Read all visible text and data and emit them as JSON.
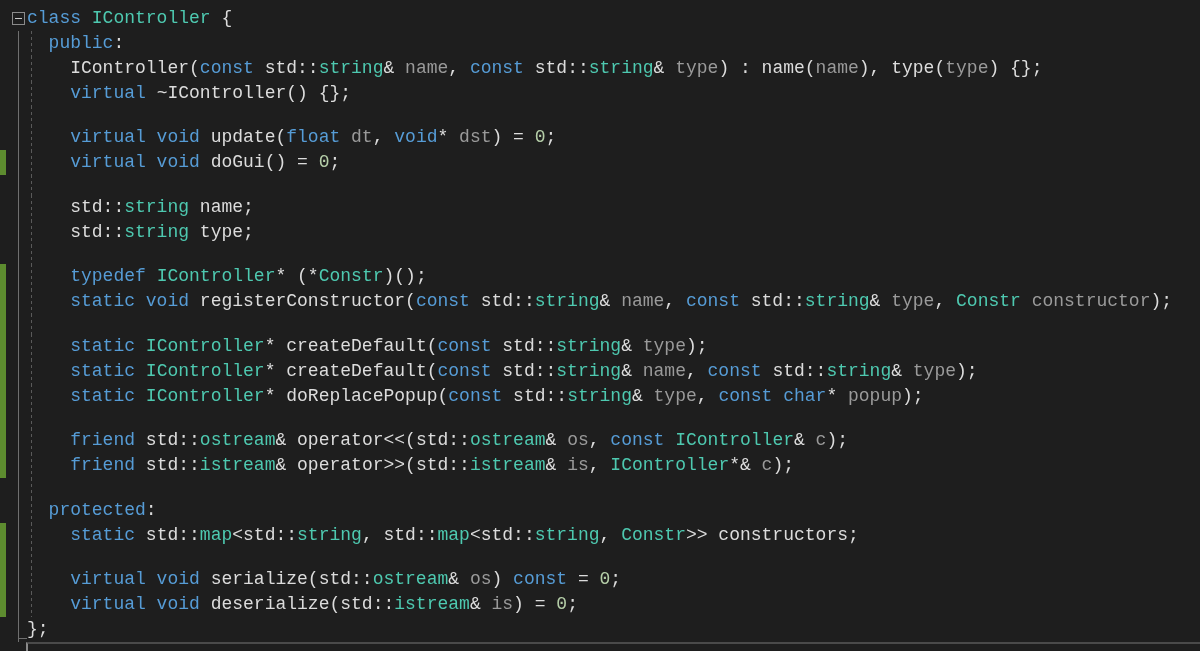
{
  "editor": {
    "lines": [
      {
        "kind": "fold-start",
        "changed": false,
        "tokens": [
          {
            "kind": "keyword",
            "text": "class "
          },
          {
            "kind": "type",
            "text": "IController"
          },
          {
            "kind": "plain",
            "text": " {"
          }
        ]
      },
      {
        "kind": "code",
        "changed": false,
        "tokens": [
          {
            "kind": "keyword",
            "text": "  public"
          },
          {
            "kind": "plain",
            "text": ":"
          }
        ]
      },
      {
        "kind": "code",
        "changed": false,
        "tokens": [
          {
            "kind": "plain",
            "text": "    IController("
          },
          {
            "kind": "keyword",
            "text": "const"
          },
          {
            "kind": "plain",
            "text": " std::"
          },
          {
            "kind": "type",
            "text": "string"
          },
          {
            "kind": "plain",
            "text": "& "
          },
          {
            "kind": "param",
            "text": "name"
          },
          {
            "kind": "plain",
            "text": ", "
          },
          {
            "kind": "keyword",
            "text": "const"
          },
          {
            "kind": "plain",
            "text": " std::"
          },
          {
            "kind": "type",
            "text": "string"
          },
          {
            "kind": "plain",
            "text": "& "
          },
          {
            "kind": "param",
            "text": "type"
          },
          {
            "kind": "plain",
            "text": ") : name("
          },
          {
            "kind": "param",
            "text": "name"
          },
          {
            "kind": "plain",
            "text": "), type("
          },
          {
            "kind": "param",
            "text": "type"
          },
          {
            "kind": "plain",
            "text": ") {};"
          }
        ]
      },
      {
        "kind": "code",
        "changed": false,
        "tokens": [
          {
            "kind": "keyword",
            "text": "    virtual"
          },
          {
            "kind": "plain",
            "text": " ~IController() {};"
          }
        ]
      },
      {
        "kind": "blank",
        "changed": false
      },
      {
        "kind": "code",
        "changed": false,
        "tokens": [
          {
            "kind": "keyword",
            "text": "    virtual void"
          },
          {
            "kind": "plain",
            "text": " update("
          },
          {
            "kind": "keyword",
            "text": "float"
          },
          {
            "kind": "param",
            "text": " dt"
          },
          {
            "kind": "plain",
            "text": ", "
          },
          {
            "kind": "keyword",
            "text": "void"
          },
          {
            "kind": "plain",
            "text": "* "
          },
          {
            "kind": "param",
            "text": "dst"
          },
          {
            "kind": "plain",
            "text": ") = "
          },
          {
            "kind": "number",
            "text": "0"
          },
          {
            "kind": "plain",
            "text": ";"
          }
        ]
      },
      {
        "kind": "code",
        "changed": true,
        "tokens": [
          {
            "kind": "keyword",
            "text": "    virtual void"
          },
          {
            "kind": "plain",
            "text": " doGui() = "
          },
          {
            "kind": "number",
            "text": "0"
          },
          {
            "kind": "plain",
            "text": ";"
          }
        ]
      },
      {
        "kind": "blank",
        "changed": false
      },
      {
        "kind": "code",
        "changed": false,
        "tokens": [
          {
            "kind": "plain",
            "text": "    std::"
          },
          {
            "kind": "type",
            "text": "string"
          },
          {
            "kind": "plain",
            "text": " name;"
          }
        ]
      },
      {
        "kind": "code",
        "changed": false,
        "tokens": [
          {
            "kind": "plain",
            "text": "    std::"
          },
          {
            "kind": "type",
            "text": "string"
          },
          {
            "kind": "plain",
            "text": " type;"
          }
        ]
      },
      {
        "kind": "blank",
        "changed": false
      },
      {
        "kind": "code",
        "changed": true,
        "tokens": [
          {
            "kind": "keyword",
            "text": "    typedef "
          },
          {
            "kind": "type",
            "text": "IController"
          },
          {
            "kind": "plain",
            "text": "* (*"
          },
          {
            "kind": "type",
            "text": "Constr"
          },
          {
            "kind": "plain",
            "text": ")();"
          }
        ]
      },
      {
        "kind": "code",
        "changed": true,
        "tokens": [
          {
            "kind": "keyword",
            "text": "    static void"
          },
          {
            "kind": "plain",
            "text": " registerConstructor("
          },
          {
            "kind": "keyword",
            "text": "const"
          },
          {
            "kind": "plain",
            "text": " std::"
          },
          {
            "kind": "type",
            "text": "string"
          },
          {
            "kind": "plain",
            "text": "& "
          },
          {
            "kind": "param",
            "text": "name"
          },
          {
            "kind": "plain",
            "text": ", "
          },
          {
            "kind": "keyword",
            "text": "const"
          },
          {
            "kind": "plain",
            "text": " std::"
          },
          {
            "kind": "type",
            "text": "string"
          },
          {
            "kind": "plain",
            "text": "& "
          },
          {
            "kind": "param",
            "text": "type"
          },
          {
            "kind": "plain",
            "text": ", "
          },
          {
            "kind": "type",
            "text": "Constr"
          },
          {
            "kind": "param",
            "text": " constructor"
          },
          {
            "kind": "plain",
            "text": ");"
          }
        ]
      },
      {
        "kind": "blank",
        "changed": true
      },
      {
        "kind": "code",
        "changed": true,
        "tokens": [
          {
            "kind": "keyword",
            "text": "    static "
          },
          {
            "kind": "type",
            "text": "IController"
          },
          {
            "kind": "plain",
            "text": "* createDefault("
          },
          {
            "kind": "keyword",
            "text": "const"
          },
          {
            "kind": "plain",
            "text": " std::"
          },
          {
            "kind": "type",
            "text": "string"
          },
          {
            "kind": "plain",
            "text": "& "
          },
          {
            "kind": "param",
            "text": "type"
          },
          {
            "kind": "plain",
            "text": ");"
          }
        ]
      },
      {
        "kind": "code",
        "changed": true,
        "tokens": [
          {
            "kind": "keyword",
            "text": "    static "
          },
          {
            "kind": "type",
            "text": "IController"
          },
          {
            "kind": "plain",
            "text": "* createDefault("
          },
          {
            "kind": "keyword",
            "text": "const"
          },
          {
            "kind": "plain",
            "text": " std::"
          },
          {
            "kind": "type",
            "text": "string"
          },
          {
            "kind": "plain",
            "text": "& "
          },
          {
            "kind": "param",
            "text": "name"
          },
          {
            "kind": "plain",
            "text": ", "
          },
          {
            "kind": "keyword",
            "text": "const"
          },
          {
            "kind": "plain",
            "text": " std::"
          },
          {
            "kind": "type",
            "text": "string"
          },
          {
            "kind": "plain",
            "text": "& "
          },
          {
            "kind": "param",
            "text": "type"
          },
          {
            "kind": "plain",
            "text": ");"
          }
        ]
      },
      {
        "kind": "code",
        "changed": true,
        "tokens": [
          {
            "kind": "keyword",
            "text": "    static "
          },
          {
            "kind": "type",
            "text": "IController"
          },
          {
            "kind": "plain",
            "text": "* doReplacePopup("
          },
          {
            "kind": "keyword",
            "text": "const"
          },
          {
            "kind": "plain",
            "text": " std::"
          },
          {
            "kind": "type",
            "text": "string"
          },
          {
            "kind": "plain",
            "text": "& "
          },
          {
            "kind": "param",
            "text": "type"
          },
          {
            "kind": "plain",
            "text": ", "
          },
          {
            "kind": "keyword",
            "text": "const char"
          },
          {
            "kind": "plain",
            "text": "* "
          },
          {
            "kind": "param",
            "text": "popup"
          },
          {
            "kind": "plain",
            "text": ");"
          }
        ]
      },
      {
        "kind": "blank",
        "changed": true
      },
      {
        "kind": "code",
        "changed": true,
        "tokens": [
          {
            "kind": "keyword",
            "text": "    friend"
          },
          {
            "kind": "plain",
            "text": " std::"
          },
          {
            "kind": "type",
            "text": "ostream"
          },
          {
            "kind": "plain",
            "text": "& operator<<(std::"
          },
          {
            "kind": "type",
            "text": "ostream"
          },
          {
            "kind": "plain",
            "text": "& "
          },
          {
            "kind": "param",
            "text": "os"
          },
          {
            "kind": "plain",
            "text": ", "
          },
          {
            "kind": "keyword",
            "text": "const "
          },
          {
            "kind": "type",
            "text": "IController"
          },
          {
            "kind": "plain",
            "text": "& "
          },
          {
            "kind": "param",
            "text": "c"
          },
          {
            "kind": "plain",
            "text": ");"
          }
        ]
      },
      {
        "kind": "code",
        "changed": true,
        "tokens": [
          {
            "kind": "keyword",
            "text": "    friend"
          },
          {
            "kind": "plain",
            "text": " std::"
          },
          {
            "kind": "type",
            "text": "istream"
          },
          {
            "kind": "plain",
            "text": "& operator>>(std::"
          },
          {
            "kind": "type",
            "text": "istream"
          },
          {
            "kind": "plain",
            "text": "& "
          },
          {
            "kind": "param",
            "text": "is"
          },
          {
            "kind": "plain",
            "text": ", "
          },
          {
            "kind": "type",
            "text": "IController"
          },
          {
            "kind": "plain",
            "text": "*& "
          },
          {
            "kind": "param",
            "text": "c"
          },
          {
            "kind": "plain",
            "text": ");"
          }
        ]
      },
      {
        "kind": "blank",
        "changed": false
      },
      {
        "kind": "code",
        "changed": false,
        "tokens": [
          {
            "kind": "keyword",
            "text": "  protected"
          },
          {
            "kind": "plain",
            "text": ":"
          }
        ]
      },
      {
        "kind": "code",
        "changed": true,
        "tokens": [
          {
            "kind": "keyword",
            "text": "    static"
          },
          {
            "kind": "plain",
            "text": " std::"
          },
          {
            "kind": "type",
            "text": "map"
          },
          {
            "kind": "plain",
            "text": "<std::"
          },
          {
            "kind": "type",
            "text": "string"
          },
          {
            "kind": "plain",
            "text": ", std::"
          },
          {
            "kind": "type",
            "text": "map"
          },
          {
            "kind": "plain",
            "text": "<std::"
          },
          {
            "kind": "type",
            "text": "string"
          },
          {
            "kind": "plain",
            "text": ", "
          },
          {
            "kind": "type",
            "text": "Constr"
          },
          {
            "kind": "plain",
            "text": ">> constructors;"
          }
        ]
      },
      {
        "kind": "blank",
        "changed": true
      },
      {
        "kind": "code",
        "changed": true,
        "tokens": [
          {
            "kind": "keyword",
            "text": "    virtual void"
          },
          {
            "kind": "plain",
            "text": " serialize(std::"
          },
          {
            "kind": "type",
            "text": "ostream"
          },
          {
            "kind": "plain",
            "text": "& "
          },
          {
            "kind": "param",
            "text": "os"
          },
          {
            "kind": "plain",
            "text": ") "
          },
          {
            "kind": "keyword",
            "text": "const"
          },
          {
            "kind": "plain",
            "text": " = "
          },
          {
            "kind": "number",
            "text": "0"
          },
          {
            "kind": "plain",
            "text": ";"
          }
        ]
      },
      {
        "kind": "code",
        "changed": true,
        "tokens": [
          {
            "kind": "keyword",
            "text": "    virtual void"
          },
          {
            "kind": "plain",
            "text": " deserialize(std::"
          },
          {
            "kind": "type",
            "text": "istream"
          },
          {
            "kind": "plain",
            "text": "& "
          },
          {
            "kind": "param",
            "text": "is"
          },
          {
            "kind": "plain",
            "text": ") = "
          },
          {
            "kind": "number",
            "text": "0"
          },
          {
            "kind": "plain",
            "text": ";"
          }
        ]
      },
      {
        "kind": "fold-end",
        "changed": false,
        "tokens": [
          {
            "kind": "plain",
            "text": "};"
          }
        ]
      }
    ]
  }
}
